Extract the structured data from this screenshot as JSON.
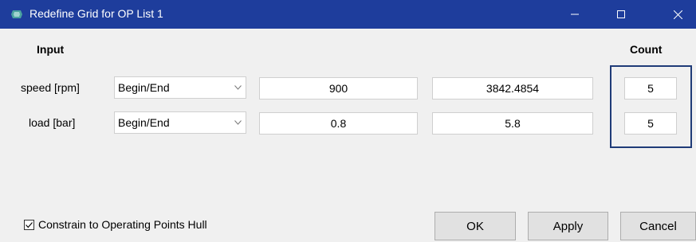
{
  "window": {
    "title": "Redefine Grid for OP List 1",
    "app_icon": "app-icon",
    "controls": [
      "minimize-icon",
      "maximize-icon",
      "close-icon"
    ]
  },
  "headers": {
    "input": "Input",
    "count": "Count"
  },
  "rows": [
    {
      "label": "speed [rpm]",
      "mode": "Begin/End",
      "begin": "900",
      "end": "3842.4854",
      "count": "5"
    },
    {
      "label": "load [bar]",
      "mode": "Begin/End",
      "begin": "0.8",
      "end": "5.8",
      "count": "5"
    }
  ],
  "constrain": {
    "label": "Constrain to Operating Points Hull",
    "checked": true
  },
  "buttons": {
    "ok": "OK",
    "apply": "Apply",
    "cancel": "Cancel"
  },
  "colors": {
    "titlebar": "#1e3d9c",
    "count_highlight": "#1f3b78",
    "background": "#f0f0f0"
  }
}
